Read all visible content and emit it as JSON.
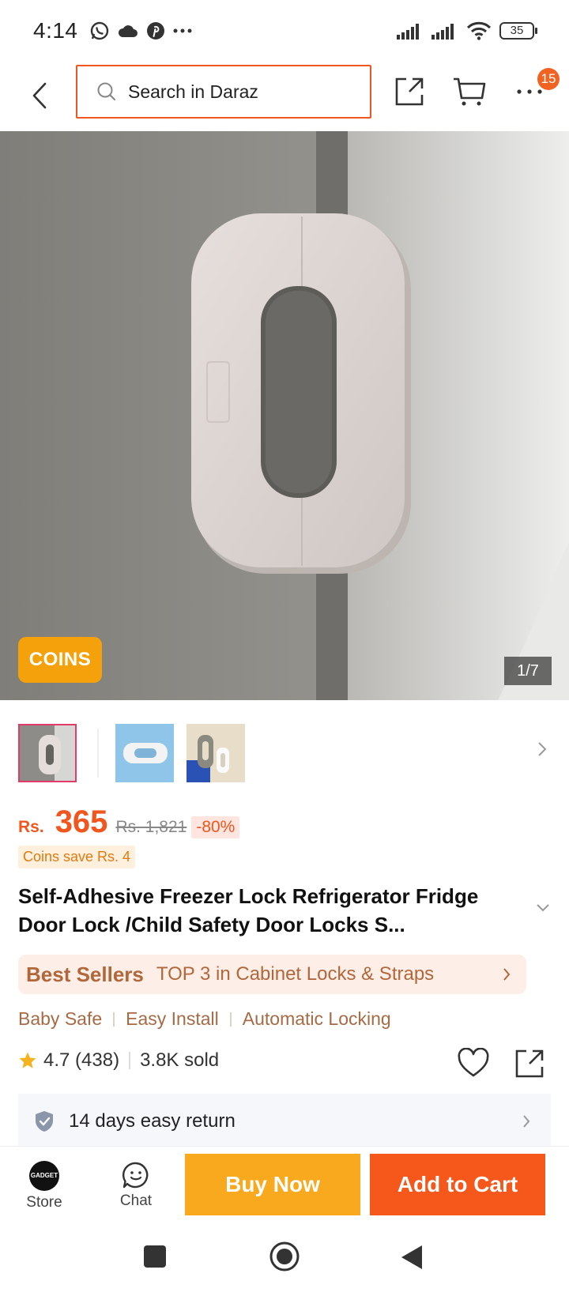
{
  "status_bar": {
    "time": "4:14",
    "battery": "35",
    "left_icons": [
      "whatsapp-icon",
      "cloud-icon",
      "pinterest-icon",
      "more-dots-icon"
    ],
    "right_icons": [
      "signal-icon",
      "signal-icon",
      "wifi-icon",
      "battery-icon"
    ]
  },
  "header": {
    "search_placeholder": "Search in Daraz",
    "cart_badge": "15"
  },
  "gallery": {
    "coins_label": "COINS",
    "counter": "1/7",
    "thumbnails": [
      "thumbnail-1",
      "thumbnail-2",
      "thumbnail-3"
    ]
  },
  "price": {
    "currency": "Rs.",
    "current": "365",
    "original": "Rs. 1,821",
    "discount": "-80%",
    "coins_save": "Coins save Rs. 4"
  },
  "product": {
    "title": "Self-Adhesive Freezer Lock Refrigerator Fridge Door Lock /Child Safety Door Locks S..."
  },
  "best_sellers": {
    "label": "Best Sellers",
    "rank": "TOP 3 in Cabinet Locks & Straps"
  },
  "tags": [
    "Baby Safe",
    "Easy Install",
    "Automatic Locking"
  ],
  "rating": {
    "score": "4.7 (438)",
    "sold": "3.8K sold"
  },
  "return_policy": {
    "text": "14 days easy return"
  },
  "bottom_bar": {
    "store_label": "Store",
    "store_logo_text": "GADGET",
    "chat_label": "Chat",
    "buy_now": "Buy Now",
    "add_to_cart": "Add to Cart"
  },
  "colors": {
    "accent": "#f0561d",
    "buy_now": "#f8a91d",
    "add_to_cart": "#f6581b",
    "coins": "#f5a10b",
    "best_sellers_bg": "#fdeee7"
  }
}
